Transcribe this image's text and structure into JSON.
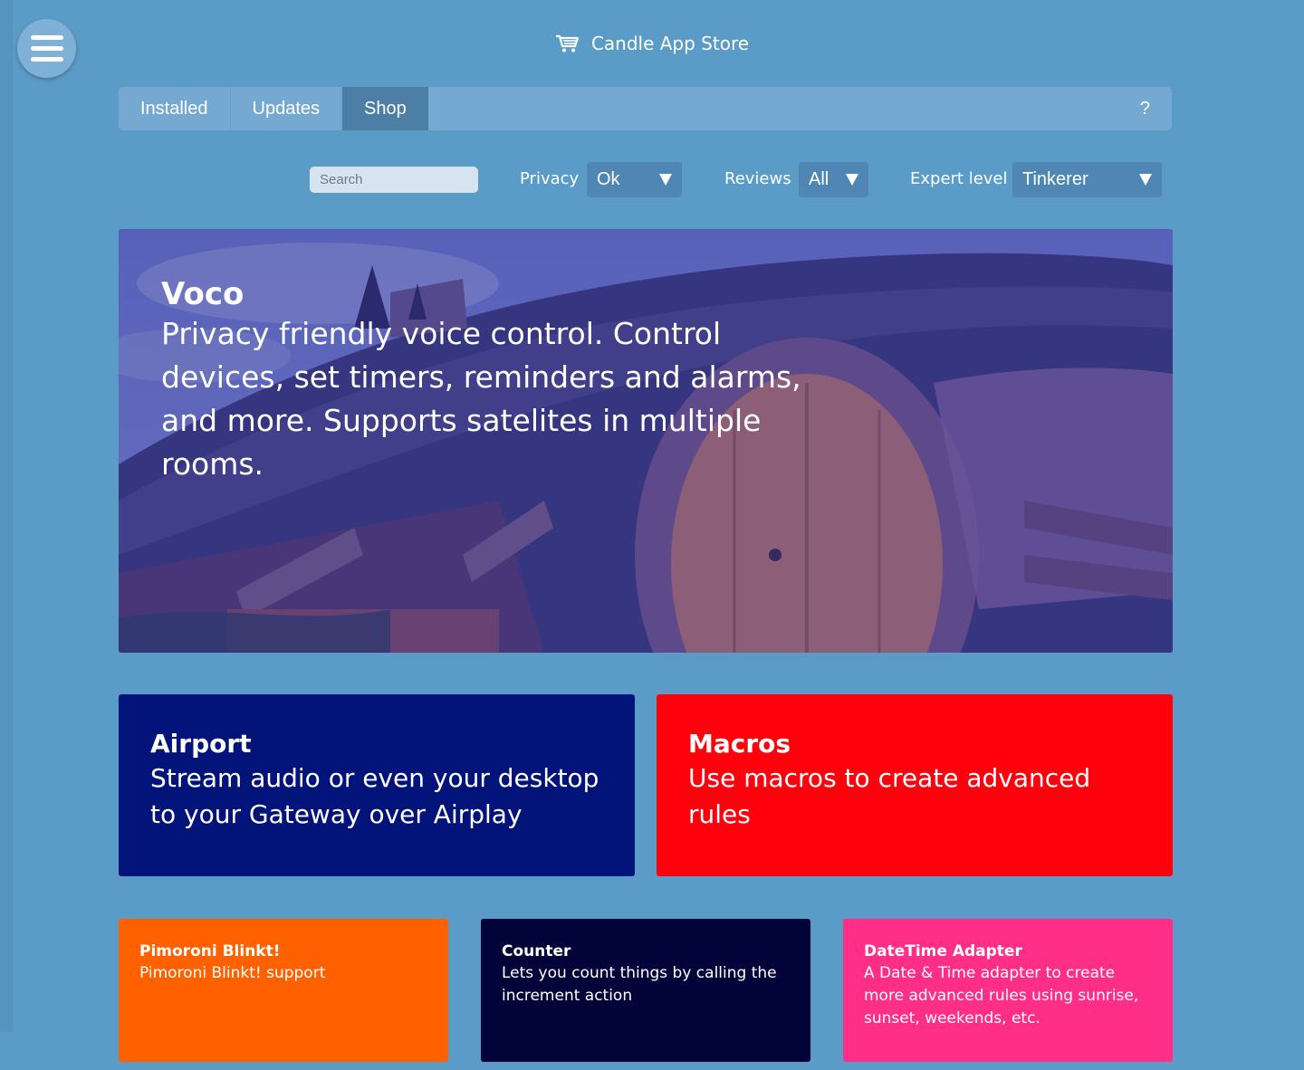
{
  "app": {
    "title": "Candle App Store",
    "menu_icon": "hamburger-icon",
    "title_icon": "cart-icon"
  },
  "tabs": [
    {
      "label": "Installed",
      "active": false
    },
    {
      "label": "Updates",
      "active": false
    },
    {
      "label": "Shop",
      "active": true
    }
  ],
  "help_label": "?",
  "filters": {
    "search_placeholder": "Search",
    "privacy": {
      "label": "Privacy",
      "value": "Ok"
    },
    "reviews": {
      "label": "Reviews",
      "value": "All"
    },
    "expert": {
      "label": "Expert level",
      "value": "Tinkerer"
    }
  },
  "featured": {
    "title": "Voco",
    "description": "Privacy friendly voice control. Control devices, set timers, reminders and alarms, and more. Supports satelites in multiple rooms."
  },
  "cards_large": [
    {
      "title": "Airport",
      "description": "Stream audio or even your desktop to your Gateway over Airplay",
      "color": "#021379"
    },
    {
      "title": "Macros",
      "description": "Use macros to create advanced rules",
      "color": "#ff000d"
    }
  ],
  "cards_small": [
    {
      "title": "Pimoroni Blinkt!",
      "description": "Pimoroni Blinkt! support",
      "color": "#ff6100"
    },
    {
      "title": "Counter",
      "description": "Lets you count things by calling the increment action",
      "color": "#020439"
    },
    {
      "title": "DateTime Adapter",
      "description": "A Date & Time adapter to create more advanced rules using sunrise, sunset, weekends, etc.",
      "color": "#ff2e87"
    }
  ],
  "colors": {
    "background": "#5b9bc8",
    "tabbar": "#75a9d2",
    "tab_active": "#4d7fa6",
    "select": "#4f86b4"
  }
}
